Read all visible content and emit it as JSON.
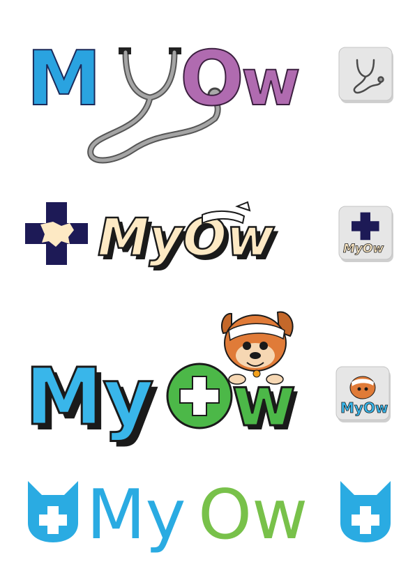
{
  "brand": {
    "name": "MyOw",
    "logo1_letters": [
      "M",
      "y",
      "O",
      "w"
    ],
    "logo2_word": "MyOw",
    "logo3_letters": [
      "My",
      "O",
      "w"
    ],
    "logo4_letters": [
      "My",
      "Ow"
    ]
  },
  "colors": {
    "logo1_m": "#2aa3e0",
    "logo1_ow": "#b06bb0",
    "stethoscope": "#8a8a8a",
    "logo2_fill": "#fde9c4",
    "logo2_navy": "#1d1a56",
    "logo3_my": "#39b6ea",
    "logo3_ow": "#4cb848",
    "logo4_blue": "#2aabe2",
    "logo4_green": "#78c14a"
  },
  "icons": [
    "stethoscope-icon",
    "medical-cross-dog-icon",
    "bandaged-dog-mascot-icon",
    "cat-head-cross-icon"
  ]
}
